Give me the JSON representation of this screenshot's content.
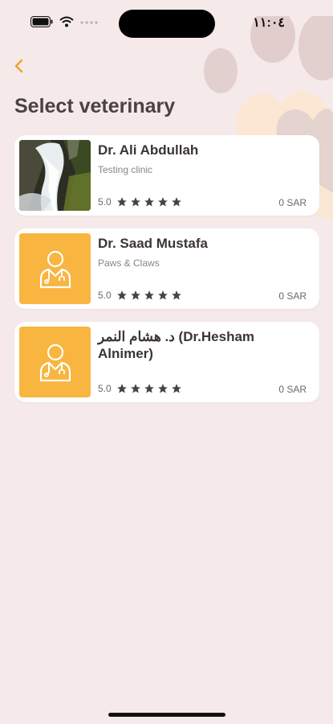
{
  "status_bar": {
    "time": "١١:٠٤"
  },
  "header": {
    "back_icon": "chevron-left-icon",
    "title": "Select veterinary"
  },
  "colors": {
    "background": "#f5e9e9",
    "accent": "#f8b53f",
    "card": "#ffffff",
    "star": "#4a4240"
  },
  "vets": [
    {
      "name": "Dr. Ali Abdullah",
      "clinic": "Testing clinic",
      "rating": "5.0",
      "stars": 5,
      "price": "0 SAR",
      "avatar": "waterfall-photo"
    },
    {
      "name": "Dr. Saad Mustafa",
      "clinic": "Paws & Claws",
      "rating": "5.0",
      "stars": 5,
      "price": "0 SAR",
      "avatar": "doctor-icon"
    },
    {
      "name": "د. هشام النمر (Dr.Hesham Alnimer)",
      "clinic": "",
      "rating": "5.0",
      "stars": 5,
      "price": "0 SAR",
      "avatar": "doctor-icon"
    }
  ]
}
